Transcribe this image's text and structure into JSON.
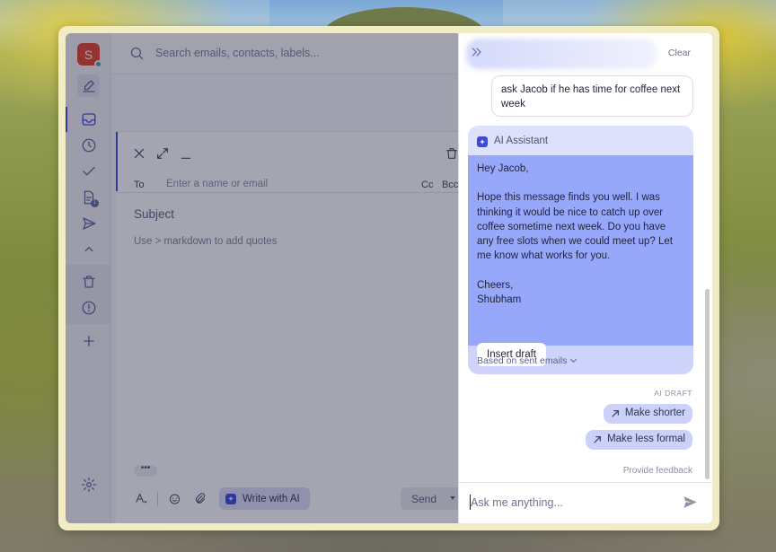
{
  "rail": {
    "avatar_letter": "S",
    "draft_badge": "1",
    "items": [
      "compose-icon",
      "inbox-icon",
      "clock-icon",
      "check-icon",
      "drafts-icon",
      "send-icon",
      "chevron-up-icon",
      "trash-icon",
      "alert-icon",
      "plus-icon",
      "gear-icon"
    ]
  },
  "search": {
    "placeholder": "Search emails, contacts, labels..."
  },
  "compose": {
    "to_label": "To",
    "to_placeholder": "Enter a name or email",
    "cc": "Cc",
    "bcc": "Bcc",
    "subject_placeholder": "Subject",
    "body_hint": "Use > markdown to add quotes",
    "more": "•••",
    "write_ai": "Write with AI",
    "send": "Send"
  },
  "assistant": {
    "clear": "Clear",
    "user_message": "ask Jacob if he has time for coffee next week",
    "title": "AI Assistant",
    "draft": {
      "greeting": "Hey Jacob,",
      "body": "Hope this message finds you well. I was thinking it would be nice to catch up over coffee sometime next week. Do you have any free slots when we could meet up? Let me know what works for you.",
      "signoff": "Cheers,",
      "name": "Shubham"
    },
    "insert_draft": "Insert draft",
    "based_on": "Based on sent emails",
    "draft_label": "AI DRAFT",
    "suggestions": [
      "Make shorter",
      "Make less formal"
    ],
    "feedback": "Provide feedback",
    "input_placeholder": "Ask me anything..."
  },
  "colors": {
    "accent": "#3b4bd8",
    "avatar": "#e0432b",
    "ai_card": "#97a8fb",
    "chip": "#cbd1f8"
  }
}
